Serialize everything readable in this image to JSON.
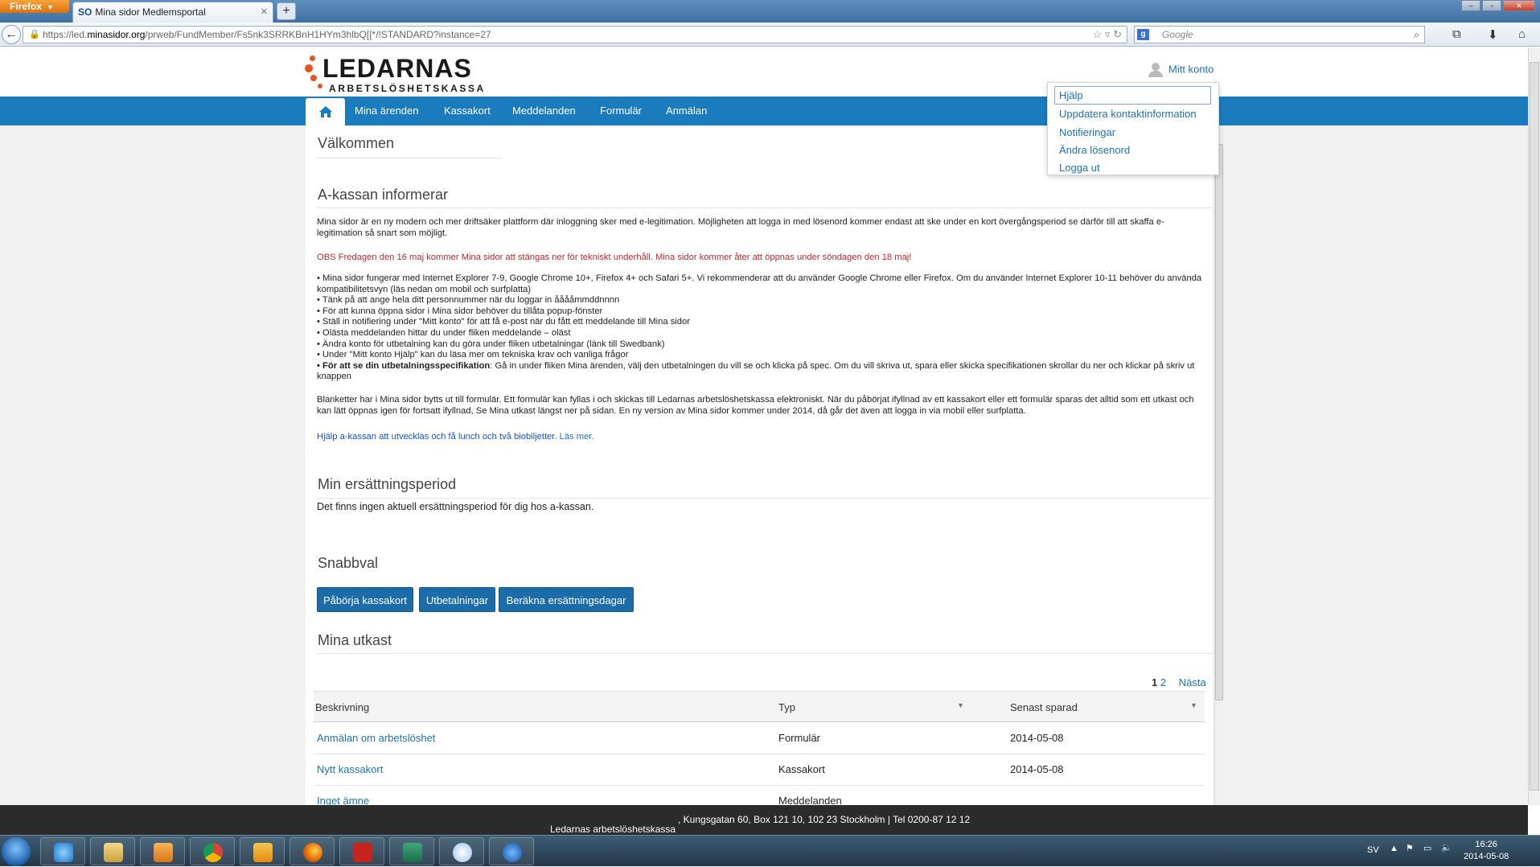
{
  "browser": {
    "menu_label": "Firefox",
    "tab_title": "Mina sidor Medlemsportal",
    "tab_favicon": "SO",
    "url_prefix": "https://led.",
    "url_domain": "minasidor.org",
    "url_rest": "/prweb/FundMember/Fs5nk3SRRKBnH1HYm3hlbQ[[*/!STANDARD?instance=27",
    "search_placeholder": "Google"
  },
  "header": {
    "logo_word": "LEDARNAS",
    "logo_sub": "ARBETSLÖSHETSKASSA",
    "account_label": "Mitt konto"
  },
  "nav": {
    "items": [
      "Mina ärenden",
      "Kassakort",
      "Meddelanden",
      "Formulär",
      "Anmälan"
    ]
  },
  "account_menu": {
    "items": [
      "Hjälp",
      "Uppdatera kontaktinformation",
      "Notifieringar",
      "Ändra lösenord",
      "Logga ut"
    ]
  },
  "welcome": {
    "title": "Välkommen"
  },
  "info": {
    "title": "A-kassan informerar",
    "intro": "Mina sidor är en ny modern och mer driftsäker plattform där inloggning sker med e-legitimation. Möjligheten att logga in med lösenord kommer endast att ske under en kort övergångsperiod se därför till att skaffa e-legitimation så snart som möjligt.",
    "notice": "OBS Fredagen den 16 maj kommer Mina sidor att stängas ner för tekniskt underhåll. Mina sidor kommer åter att öppnas under söndagen den 18 maj!",
    "bullets": [
      "• Mina sidor fungerar med Internet Explorer 7-9, Google Chrome 10+, Firefox 4+ och Safari 5+. Vi rekommenderar att du använder Google Chrome eller Firefox. Om du använder Internet Explorer 10-11 behöver du använda kompatibilitetsvyn (läs nedan om mobil och surfplatta)",
      "• Tänk på att ange hela ditt personnummer när du loggar in ååååmmddnnnn",
      "• För att kunna öppna sidor i Mina sidor behöver du tillåta popup-fönster",
      "• Ställ in notifiering under \"Mitt konto\" för att få e-post när du fått ett meddelande till Mina sidor",
      "• Olästa meddelanden hittar du under fliken meddelande – oläst",
      "• Ändra konto för utbetalning kan du göra under fliken utbetalningar (länk till Swedbank)",
      "• Under \"Mitt konto Hjälp\" kan du läsa mer om tekniska krav och vanliga frågor"
    ],
    "spec_bold": "• För att se din utbetalningsspecifikation",
    "spec_text": ": Gå in under fliken Mina ärenden, välj den utbetalningen du vill se och klicka på spec. Om du vill skriva ut, spara eller skicka specifikationen skrollar du ner och klickar på skriv ut knappen",
    "forms": "Blanketter har i Mina sidor bytts ut till formulär. Ett formulär kan fyllas i och skickas till Ledarnas arbetslöshetskassa elektroniskt. När du påbörjat ifyllnad av ett kassakort eller ett formulär sparas det alltid som ett utkast och kan lätt öppnas igen för fortsatt ifyllnad, Se Mina utkast längst ner på sidan. En ny version av Mina sidor kommer under 2014, då går det även att logga in via mobil eller surfplatta.",
    "survey": "Hjälp a-kassan att utvecklas och få lunch och två biobiljetter.",
    "survey_link": "Läs mer."
  },
  "period": {
    "title": "Min ersättningsperiod",
    "text": "Det finns ingen aktuell ersättningsperiod för dig hos a-kassan."
  },
  "quick": {
    "title": "Snabbval",
    "buttons": [
      "Påbörja kassakort",
      "Utbetalningar",
      "Beräkna ersättningsdagar"
    ]
  },
  "drafts": {
    "title": "Mina utkast",
    "pager": {
      "current": "1",
      "other": "2",
      "next": "Nästa"
    },
    "columns": [
      "Beskrivning",
      "Typ",
      "Senast sparad"
    ],
    "rows": [
      [
        "Anmälan om arbetslöshet",
        "Formulär",
        "2014-05-08"
      ],
      [
        "Nytt kassakort",
        "Kassakort",
        "2014-05-08"
      ],
      [
        "Inget ämne",
        "Meddelanden",
        ""
      ]
    ]
  },
  "footer": {
    "org": "Ledarnas arbetslöshetskassa",
    "address": ", Kungsgatan 60, Box 121 10, 102 23 Stockholm | Tel 0200-87 12 12"
  },
  "taskbar": {
    "lang": "SV",
    "time": "16:26",
    "date": "2014-05-08"
  },
  "colors": {
    "brand_blue": "#1a7cbd",
    "button_blue": "#1b6ca8",
    "logo_orange": "#e8541d",
    "notice_red": "#c0272d"
  }
}
